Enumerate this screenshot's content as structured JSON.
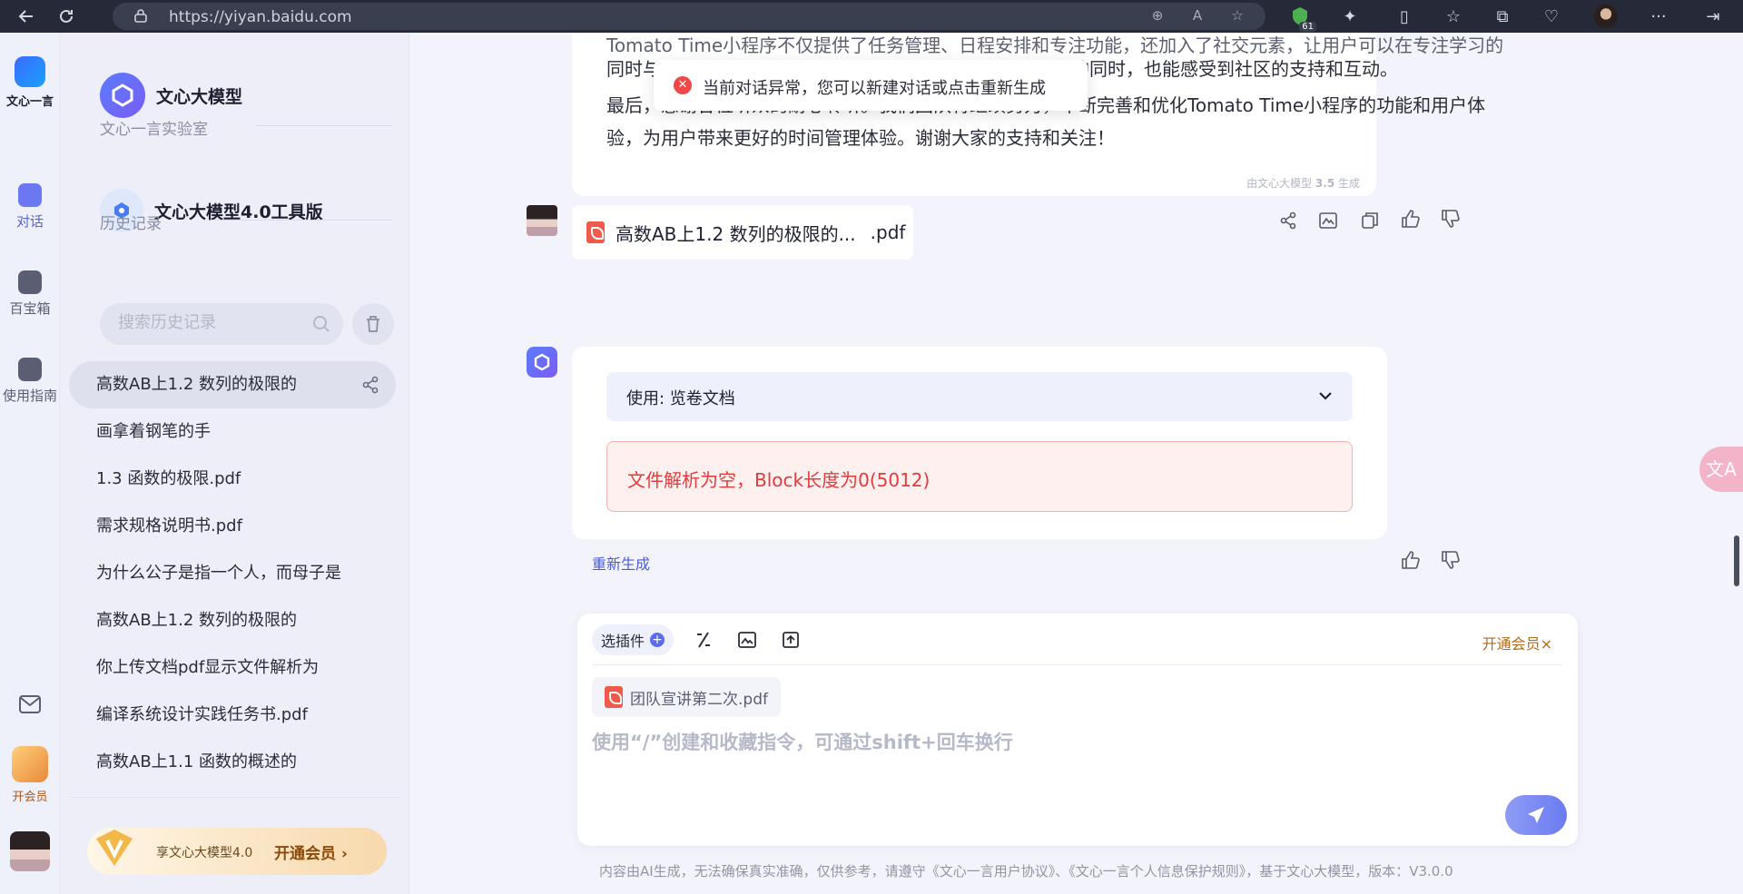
{
  "browser": {
    "url": "https://yiyan.baidu.com",
    "extension_count": "61"
  },
  "rail": {
    "brand_label": "文心一言",
    "items": [
      {
        "label": "对话"
      },
      {
        "label": "百宝箱"
      },
      {
        "label": "使用指南"
      }
    ],
    "vip_label": "开会员"
  },
  "sidebar": {
    "brand_title": "文心大模型",
    "lab_section": "文心一言实验室",
    "lab_item": "文心大模型4.0工具版",
    "history_section": "历史记录",
    "search_placeholder": "搜索历史记录",
    "history": [
      "高数AB上1.2 数列的极限的",
      "画拿着钢笔的手",
      "1.3 函数的极限.pdf",
      "需求规格说明书.pdf",
      "为什么公子是指一个人，而母子是",
      "高数AB上1.2 数列的极限的",
      "你上传文档pdf显示文件解析为",
      "编译系统设计实践任务书.pdf",
      "高数AB上1.1 函数的概述的"
    ],
    "vip_banner_text": "享文心大模型4.0",
    "vip_banner_button": "开通会员 ›"
  },
  "chat": {
    "prev_answer_line1": "Tomato Time小程序不仅提供了任务管理、日程安排和专注功能，还加入了社交元素，让用户可以在专注学习的",
    "prev_answer_line2_start": "同时与",
    "prev_answer_line2_end": "效率的同时，也能感受到社区的支持和互动。",
    "prev_answer_para2_line1": "最后，感谢各位听众的耐心聆听。我们团队将继续努力，不断完善和优化Tomato Time小程序的功能和用户体",
    "prev_answer_para2_line2": "验，为用户带来更好的时间管理体验。谢谢大家的支持和关注！",
    "generated_by_prefix": "由文心大模型 ",
    "generated_by_version": "3.5",
    "generated_by_suffix": " 生成",
    "user_file_name": "高数AB上1.2 数列的极限的...",
    "user_file_ext": ".pdf",
    "tool_usage_label": "使用: 览卷文档",
    "error_message": "文件解析为空，Block长度为0(5012)",
    "regenerate_label": "重新生成"
  },
  "toast": {
    "message": "当前对话异常，您可以新建对话或点击重新生成"
  },
  "composer": {
    "plugin_label": "选插件",
    "vip_label": "开通会员×",
    "attachment_name": "团队宣讲第二次.pdf",
    "placeholder": "使用“/”创建和收藏指令，可通过shift+回车换行"
  },
  "footer": {
    "disclaimer": "内容由AI生成，无法确保真实准确，仅供参考，请遵守《文心一言用户协议》、《文心一言个人信息保护规则》，基于文心大模型，版本：V3.0.0"
  },
  "translate_fab": "文A",
  "colors": {
    "accent": "#5b6cf0",
    "error": "#e23b3b",
    "vip": "#b06a1a"
  }
}
